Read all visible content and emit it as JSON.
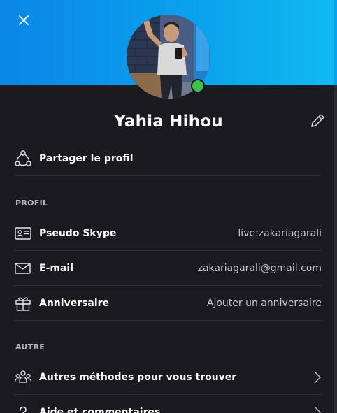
{
  "profile": {
    "display_name": "Yahia Hihou",
    "status": "online"
  },
  "actions": {
    "share_label": "Partager le profil"
  },
  "sections": {
    "profile_title": "PROFIL",
    "other_title": "AUTRE"
  },
  "profile_fields": [
    {
      "label": "Pseudo Skype",
      "value": "live:zakariagarali"
    },
    {
      "label": "E-mail",
      "value": "zakariagarali@gmail.com"
    },
    {
      "label": "Anniversaire",
      "value": "Ajouter un anniversaire"
    }
  ],
  "other_items": [
    {
      "label": "Autres méthodes pour vous trouver"
    },
    {
      "label": "Aide et commentaires"
    }
  ],
  "colors": {
    "banner_start": "#0a86e8",
    "banner_end": "#0fbaf0",
    "panel_bg": "#1b1a1f",
    "presence_online": "#3fc24c"
  },
  "icons": {
    "close": "close-icon",
    "edit": "pencil-icon",
    "share": "share-icon",
    "skype_name": "contact-card-icon",
    "email": "mail-icon",
    "birthday": "gift-icon",
    "find": "people-icon",
    "help": "question-icon",
    "chevron": "chevron-right-icon"
  }
}
